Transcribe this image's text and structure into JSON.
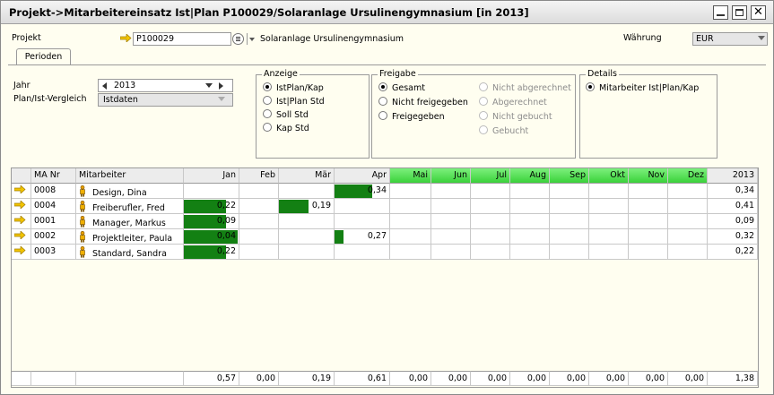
{
  "window": {
    "title": "Projekt->Mitarbeitereinsatz Ist|Plan P100029/Solaranlage Ursulinengymnasium  [in 2013]"
  },
  "header": {
    "projekt_label": "Projekt",
    "projekt_value": "P100029",
    "projekt_name": "Solaranlage Ursulinengymnasium",
    "waehrung_label": "Währung",
    "waehrung_value": "EUR"
  },
  "tabs": [
    {
      "label": "Perioden"
    }
  ],
  "filters": {
    "jahr_label": "Jahr",
    "jahr_value": "2013",
    "vergleich_label": "Plan/Ist-Vergleich",
    "vergleich_value": "Istdaten"
  },
  "anzeige": {
    "title": "Anzeige",
    "options": [
      "IstPlan/Kap",
      "Ist|Plan Std",
      "Soll Std",
      "Kap Std"
    ],
    "selected": 0
  },
  "freigabe": {
    "title": "Freigabe",
    "left_options": [
      "Gesamt",
      "Nicht freigegeben",
      "Freigegeben"
    ],
    "right_options": [
      "Nicht abgerechnet",
      "Abgerechnet",
      "Nicht gebucht",
      "Gebucht"
    ],
    "selected": 0
  },
  "details": {
    "title": "Details",
    "options": [
      "Mitarbeiter Ist|Plan/Kap"
    ],
    "selected": 0
  },
  "grid": {
    "columns": [
      "MA Nr",
      "Mitarbeiter",
      "Jan",
      "Feb",
      "Mär",
      "Apr",
      "Mai",
      "Jun",
      "Jul",
      "Aug",
      "Sep",
      "Okt",
      "Nov",
      "Dez",
      "2013"
    ],
    "rows": [
      {
        "nr": "0008",
        "name": "Design, Dina",
        "months": [
          "",
          "",
          "",
          "0,34",
          "",
          "",
          "",
          "",
          "",
          "",
          "",
          ""
        ],
        "fill": [
          0,
          0,
          0,
          0.7,
          0,
          0,
          0,
          0,
          0,
          0,
          0,
          0
        ],
        "total": "0,34"
      },
      {
        "nr": "0004",
        "name": "Freiberufler, Fred",
        "months": [
          "0,22",
          "",
          "0,19",
          "",
          "",
          "",
          "",
          "",
          "",
          "",
          "",
          ""
        ],
        "fill": [
          0.78,
          0,
          0.55,
          0,
          0,
          0,
          0,
          0,
          0,
          0,
          0,
          0
        ],
        "total": "0,41"
      },
      {
        "nr": "0001",
        "name": "Manager, Markus",
        "months": [
          "0,09",
          "",
          "",
          "",
          "",
          "",
          "",
          "",
          "",
          "",
          "",
          ""
        ],
        "fill": [
          0.78,
          0,
          0,
          0,
          0,
          0,
          0,
          0,
          0,
          0,
          0,
          0
        ],
        "total": "0,09"
      },
      {
        "nr": "0002",
        "name": "Projektleiter, Paula",
        "months": [
          "0,04",
          "",
          "",
          "0,27",
          "",
          "",
          "",
          "",
          "",
          "",
          "",
          ""
        ],
        "fill": [
          1.0,
          0,
          0,
          0.16,
          0,
          0,
          0,
          0,
          0,
          0,
          0,
          0
        ],
        "total": "0,32"
      },
      {
        "nr": "0003",
        "name": "Standard, Sandra",
        "months": [
          "0,22",
          "",
          "",
          "",
          "",
          "",
          "",
          "",
          "",
          "",
          "",
          ""
        ],
        "fill": [
          0.78,
          0,
          0,
          0,
          0,
          0,
          0,
          0,
          0,
          0,
          0,
          0
        ],
        "total": "0,22"
      }
    ],
    "totals": [
      "0,57",
      "0,00",
      "0,19",
      "0,61",
      "0,00",
      "0,00",
      "0,00",
      "0,00",
      "0,00",
      "0,00",
      "0,00",
      "0,00",
      "1,38"
    ]
  },
  "colors": {
    "bar": "#138013",
    "future_month_header": "#5fe35f",
    "link_arrow": "#f2c400"
  }
}
